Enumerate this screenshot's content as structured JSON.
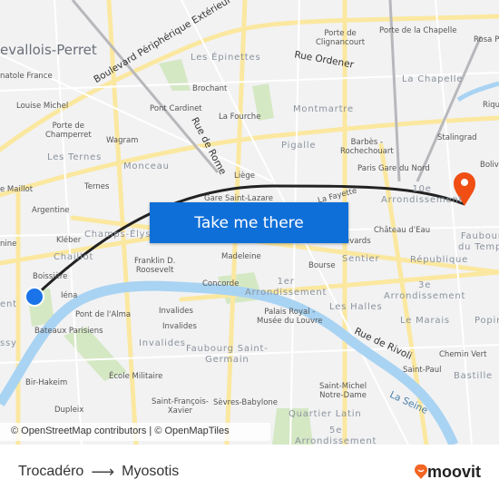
{
  "map": {
    "labels": [
      "evallois-Perret",
      "Boulevard Périphérique Extérieur",
      "natole France",
      "Louise Michel",
      "Porte de\nChamperret",
      "Wagram",
      "Les Ternes",
      "Monceau",
      "Ternes",
      "e Maillot",
      "Les Épinettes",
      "Brochant",
      "Pont Cardinet",
      "La Fourche",
      "Rue de Rome",
      "Liège",
      "Porte de\nClignancourt",
      "Porte de la Chapelle",
      "Rosa Pa",
      "Rue Ordener",
      "La Chapelle",
      "Montmartre",
      "Riqu",
      "Pigalle",
      "Barbès -\nRochechouart",
      "Stalingrad",
      "Paris Gare du Nord",
      "Boliva",
      "10e\nArrondissement",
      "Gare Saint-Lazare",
      "La Fayette",
      "Argentine",
      "Kléber",
      "Champs-Élysées",
      "Chaillot",
      "Boissière",
      "Iéna",
      "Franklin D.\nRoosevelt",
      "Madeleine",
      "Concorde",
      "1er\nArrondissement",
      "Grands Boulevards",
      "Château d'Eau",
      "Faubourg\ndu Temple",
      "Bourse",
      "Sentier",
      "République",
      "3e\nArrondissement",
      "Palais Royal -\nMusée du Louvre",
      "Les Halles",
      "Le Marais",
      "Popin",
      "Pont de l'Alma",
      "Invalides",
      "Invalides",
      "Bateaux Parisiens",
      "Invalides",
      "Faubourg Saint-\nGermain",
      "Rue de Rivoli",
      "Chemin Vert",
      "Saint-Paul",
      "Bastille",
      "ssy",
      "ent",
      "nine",
      "École Militaire",
      "Bir-Hakeim",
      "Saint-Michel\nNotre-Dame",
      "Saint-François-\nXavier",
      "Sèvres-Babylone",
      "La Seine",
      "Dupleix",
      "Quartier Latin",
      "5e\nArrondissement"
    ],
    "origin_color": "#1a73e8",
    "destination_color": "#f04e12",
    "route_color": "#222222"
  },
  "cta": {
    "label": "Take me there",
    "color": "#0f6fd8"
  },
  "attribution": "© OpenStreetMap contributors | © OpenMapTiles",
  "footer": {
    "origin": "Trocadéro",
    "arrow": "⟶",
    "destination": "Myosotis",
    "brand": "moovit",
    "brand_color": "#f26522"
  }
}
